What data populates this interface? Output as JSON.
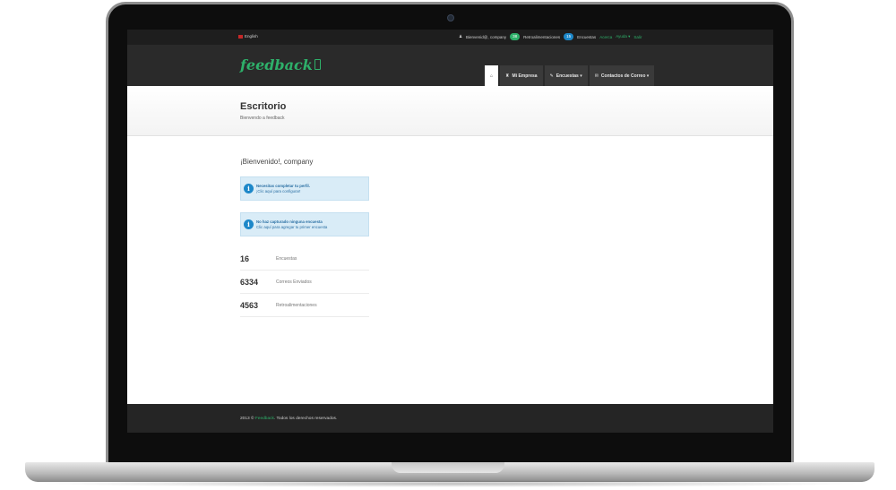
{
  "topbar": {
    "language": "English",
    "welcome_user": "Bienvenid@, company",
    "feedback_count": "38",
    "feedback_label": "Retroalimentaciones",
    "surveys_count": "15",
    "surveys_label": "Encuestas",
    "about_link": "Acerca",
    "help_link": "Ayuda ▾",
    "exit_link": "Salir"
  },
  "navbar": {
    "logo_text": "feedback",
    "tabs": [
      {
        "label": "⌂"
      },
      {
        "label": "Mi Empresa"
      },
      {
        "label": "Encuestas ▾"
      },
      {
        "label": "Contactos de Correo ▾"
      }
    ]
  },
  "header": {
    "title": "Escritorio",
    "subtitle": "Bienvendo a feedback"
  },
  "main": {
    "welcome": "¡Bienvenido!, company",
    "alerts": [
      {
        "title": "Necesitas completar tu perfil.",
        "link": "¡Clic aquí para configurar!"
      },
      {
        "title": "No haz capturado ninguna encuesta",
        "link": "Clic aquí para agregar tu primer encuesta"
      }
    ],
    "stats": [
      {
        "value": "16",
        "label": "Encuestas"
      },
      {
        "value": "6334",
        "label": "Correos Enviados"
      },
      {
        "value": "4563",
        "label": "Retroalimentaciones"
      }
    ]
  },
  "footer": {
    "prefix": "2013 © ",
    "brand": "Feedback",
    "suffix": ". Todos los derechos reservados."
  },
  "colors": {
    "accent": "#2eb06a",
    "info": "#1d88c9",
    "alert_bg": "#d9ecf7"
  }
}
